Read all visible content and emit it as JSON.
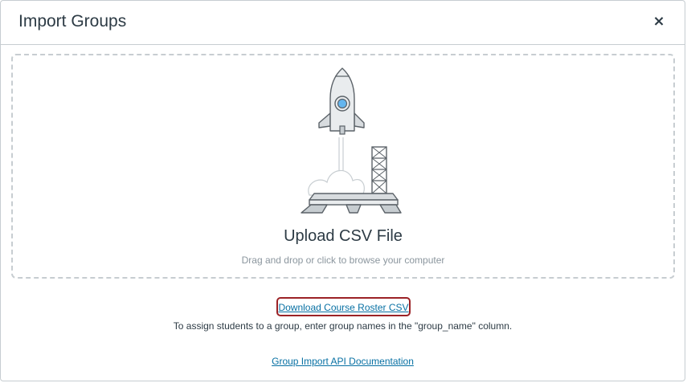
{
  "dialog": {
    "title": "Import Groups",
    "close_label": "×"
  },
  "dropzone": {
    "title": "Upload CSV File",
    "subtitle": "Drag and drop or click to browse your computer",
    "illustration_icon": "rocket-launch-icon"
  },
  "links": {
    "roster_label": "Download Course Roster CSV",
    "api_label": "Group Import API Documentation"
  },
  "instructions": "To assign students to a group, enter group names in the \"group_name\" column.",
  "colors": {
    "link": "#0770a3",
    "highlight": "#9b2226",
    "text": "#2d3b45",
    "muted": "#8b969e"
  }
}
